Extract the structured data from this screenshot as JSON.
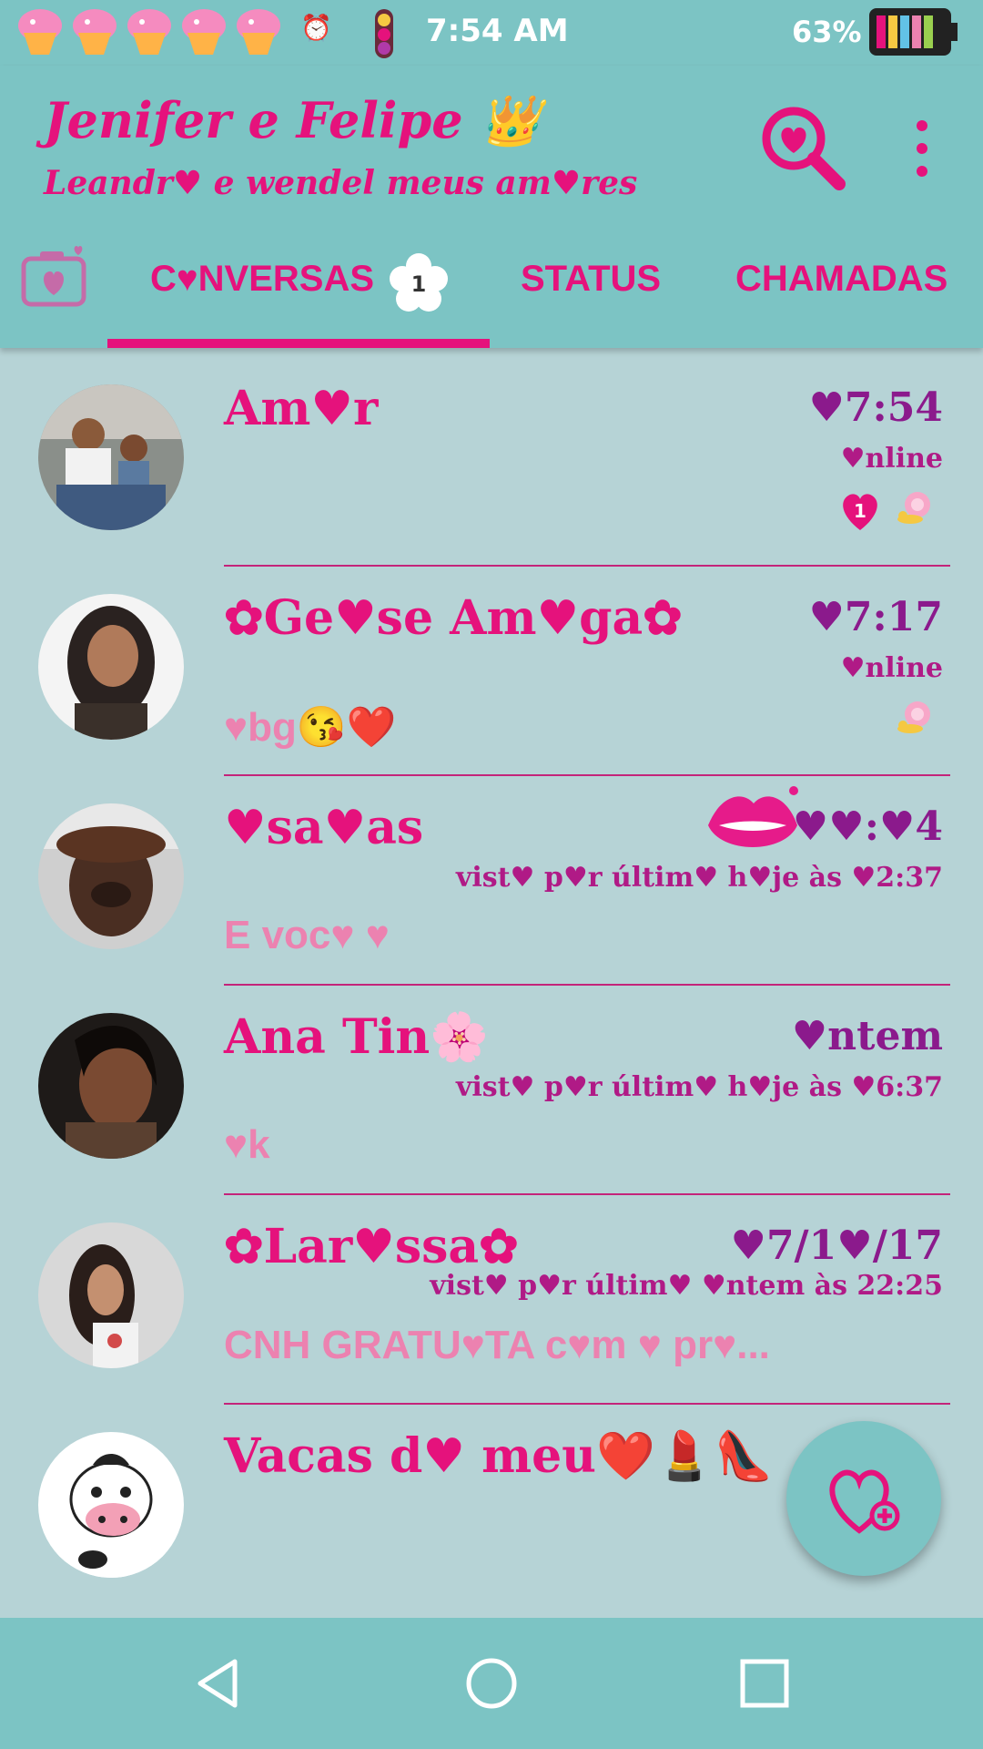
{
  "status_bar": {
    "time": "7:54 AM",
    "battery_percent": "63%",
    "alarm_icon": "alarm-icon",
    "notification_icons": [
      "cupcake-icon",
      "cupcake-icon",
      "cupcake-icon",
      "cupcake-icon",
      "cupcake-icon"
    ]
  },
  "header": {
    "title": "Jenifer e Felipe 👑",
    "subtitle": "Leandr♥ e wendel meus am♥res"
  },
  "tabs": [
    {
      "label": "C♥NVERSAS",
      "badge": "1",
      "active": true
    },
    {
      "label": "STATUS",
      "active": false
    },
    {
      "label": "CHAMADAS",
      "active": false
    }
  ],
  "chats": [
    {
      "name": "Am♥r",
      "time": "♥7:54",
      "sub": "♥nline",
      "preview": "",
      "unread": "1"
    },
    {
      "name": "✿Ge♥se Am♥ga✿",
      "time": "♥7:17",
      "sub": "♥nline",
      "preview": "♥bg😘❤️",
      "unread": ""
    },
    {
      "name": "♥sa♥as",
      "time": "♥♥:♥4",
      "sub": "vist♥ p♥r últim♥ h♥je às ♥2:37",
      "preview": "E voc♥ ♥",
      "unread": ""
    },
    {
      "name": "Ana Tin🌸",
      "time": "♥ntem",
      "sub": "vist♥ p♥r últim♥ h♥je às ♥6:37",
      "preview": "♥k",
      "unread": ""
    },
    {
      "name": "✿Lar♥ssa✿",
      "time": "♥7/1♥/17",
      "sub": "vist♥ p♥r últim♥ ♥ntem às 22:25",
      "preview": "CNH GRATU♥TA c♥m ♥ pr♥...",
      "unread": ""
    },
    {
      "name": "Vacas d♥ meu❤️💄👠",
      "time": "",
      "sub": "",
      "preview": "",
      "unread": ""
    }
  ],
  "colors": {
    "bar": "#7cc4c4",
    "background": "#b6d3d6",
    "accent": "#e5127c",
    "time": "#8b1a8c",
    "preview": "#ec82b0"
  }
}
